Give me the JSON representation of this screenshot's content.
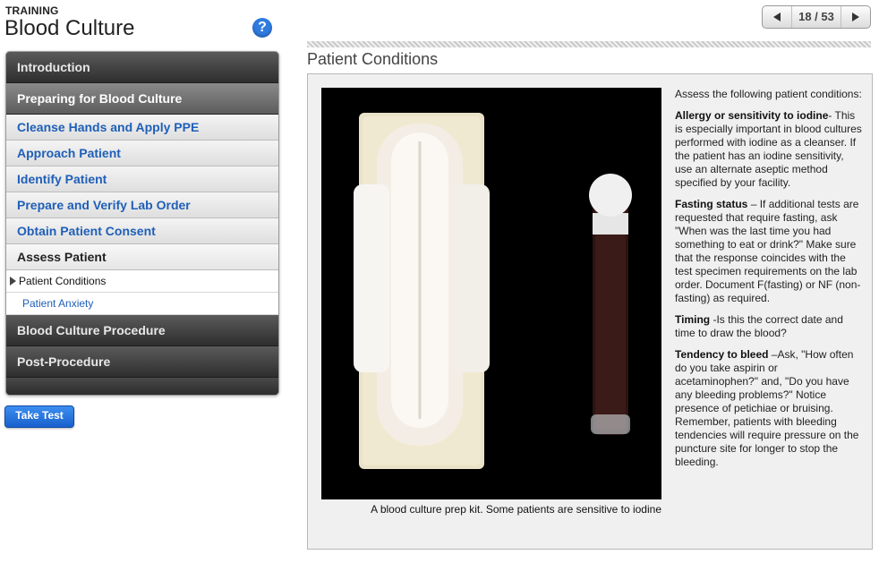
{
  "header": {
    "eyebrow": "TRAINING",
    "title": "Blood Culture",
    "help_label": "?"
  },
  "pager": {
    "count": "18 / 53"
  },
  "nav": {
    "intro": "Introduction",
    "preparing": "Preparing for Blood Culture",
    "subs": [
      "Cleanse Hands and Apply PPE",
      "Approach Patient",
      "Identify Patient",
      "Prepare and Verify Lab Order",
      "Obtain Patient Consent",
      "Assess Patient"
    ],
    "leaves": [
      "Patient Conditions",
      "Patient Anxiety"
    ],
    "procedure": "Blood Culture Procedure",
    "post": "Post-Procedure"
  },
  "take_test_label": "Take Test",
  "page_title": "Patient Conditions",
  "caption": "A blood culture prep kit. Some patients are sensitive to iodine",
  "content": {
    "intro": "Assess the following patient conditions:",
    "items": [
      {
        "term": "Allergy or sensitivity to iodine",
        "text": "- This is especially important in blood cultures performed with iodine as a cleanser. If the patient has an iodine sensitivity, use an alternate aseptic method specified by your facility."
      },
      {
        "term": "Fasting status",
        "text": " – If additional tests are requested that require fasting, ask \"When was the last time you had something to eat or drink?\" Make sure that the response coincides with the test specimen requirements on the lab order. Document F(fasting) or NF (non-fasting) as required."
      },
      {
        "term": "Timing",
        "text": " -Is this the correct date and time to draw the blood?"
      },
      {
        "term": "Tendency to bleed",
        "text": " –Ask, \"How often do you take aspirin or acetaminophen?\" and, \"Do you have any bleeding problems?\" Notice presence of petichiae or bruising. Remember, patients with bleeding tendencies will require pressure on the puncture site for longer to stop the bleeding."
      }
    ]
  }
}
